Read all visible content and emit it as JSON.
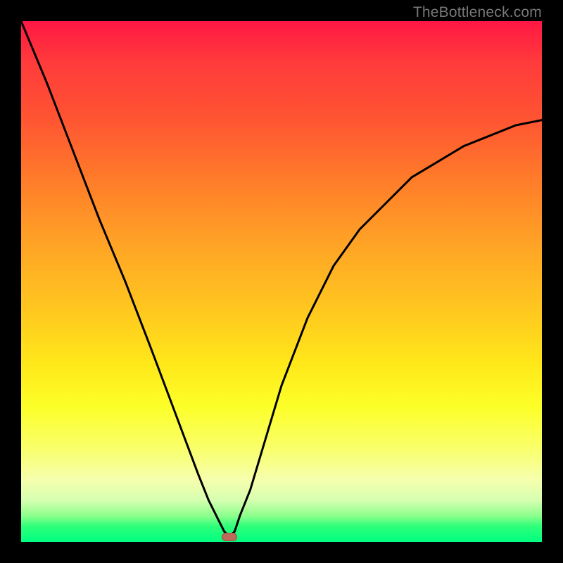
{
  "watermark": "TheBottleneck.com",
  "chart_data": {
    "type": "line",
    "title": "",
    "xlabel": "",
    "ylabel": "",
    "xlim": [
      0,
      100
    ],
    "ylim": [
      0,
      100
    ],
    "grid": false,
    "legend": false,
    "annotations": [],
    "gradient_bands": [
      {
        "position": 0,
        "color": "#ff1744"
      },
      {
        "position": 50,
        "color": "#ffcc00"
      },
      {
        "position": 90,
        "color": "#eeff66"
      },
      {
        "position": 100,
        "color": "#00ff80"
      }
    ],
    "series": [
      {
        "name": "bottleneck-curve",
        "x": [
          0,
          5,
          10,
          15,
          20,
          25,
          28,
          31,
          34,
          36,
          38,
          39,
          40,
          41,
          42,
          44,
          47,
          50,
          55,
          60,
          65,
          70,
          75,
          80,
          85,
          90,
          95,
          100
        ],
        "values": [
          100,
          88,
          75,
          62,
          50,
          37,
          29,
          21,
          13,
          8,
          4,
          2,
          1,
          2,
          5,
          10,
          20,
          30,
          43,
          53,
          60,
          65,
          70,
          73,
          76,
          78,
          80,
          81
        ]
      }
    ],
    "marker": {
      "x": 40,
      "y": 1,
      "color": "#bd6a5a"
    }
  }
}
